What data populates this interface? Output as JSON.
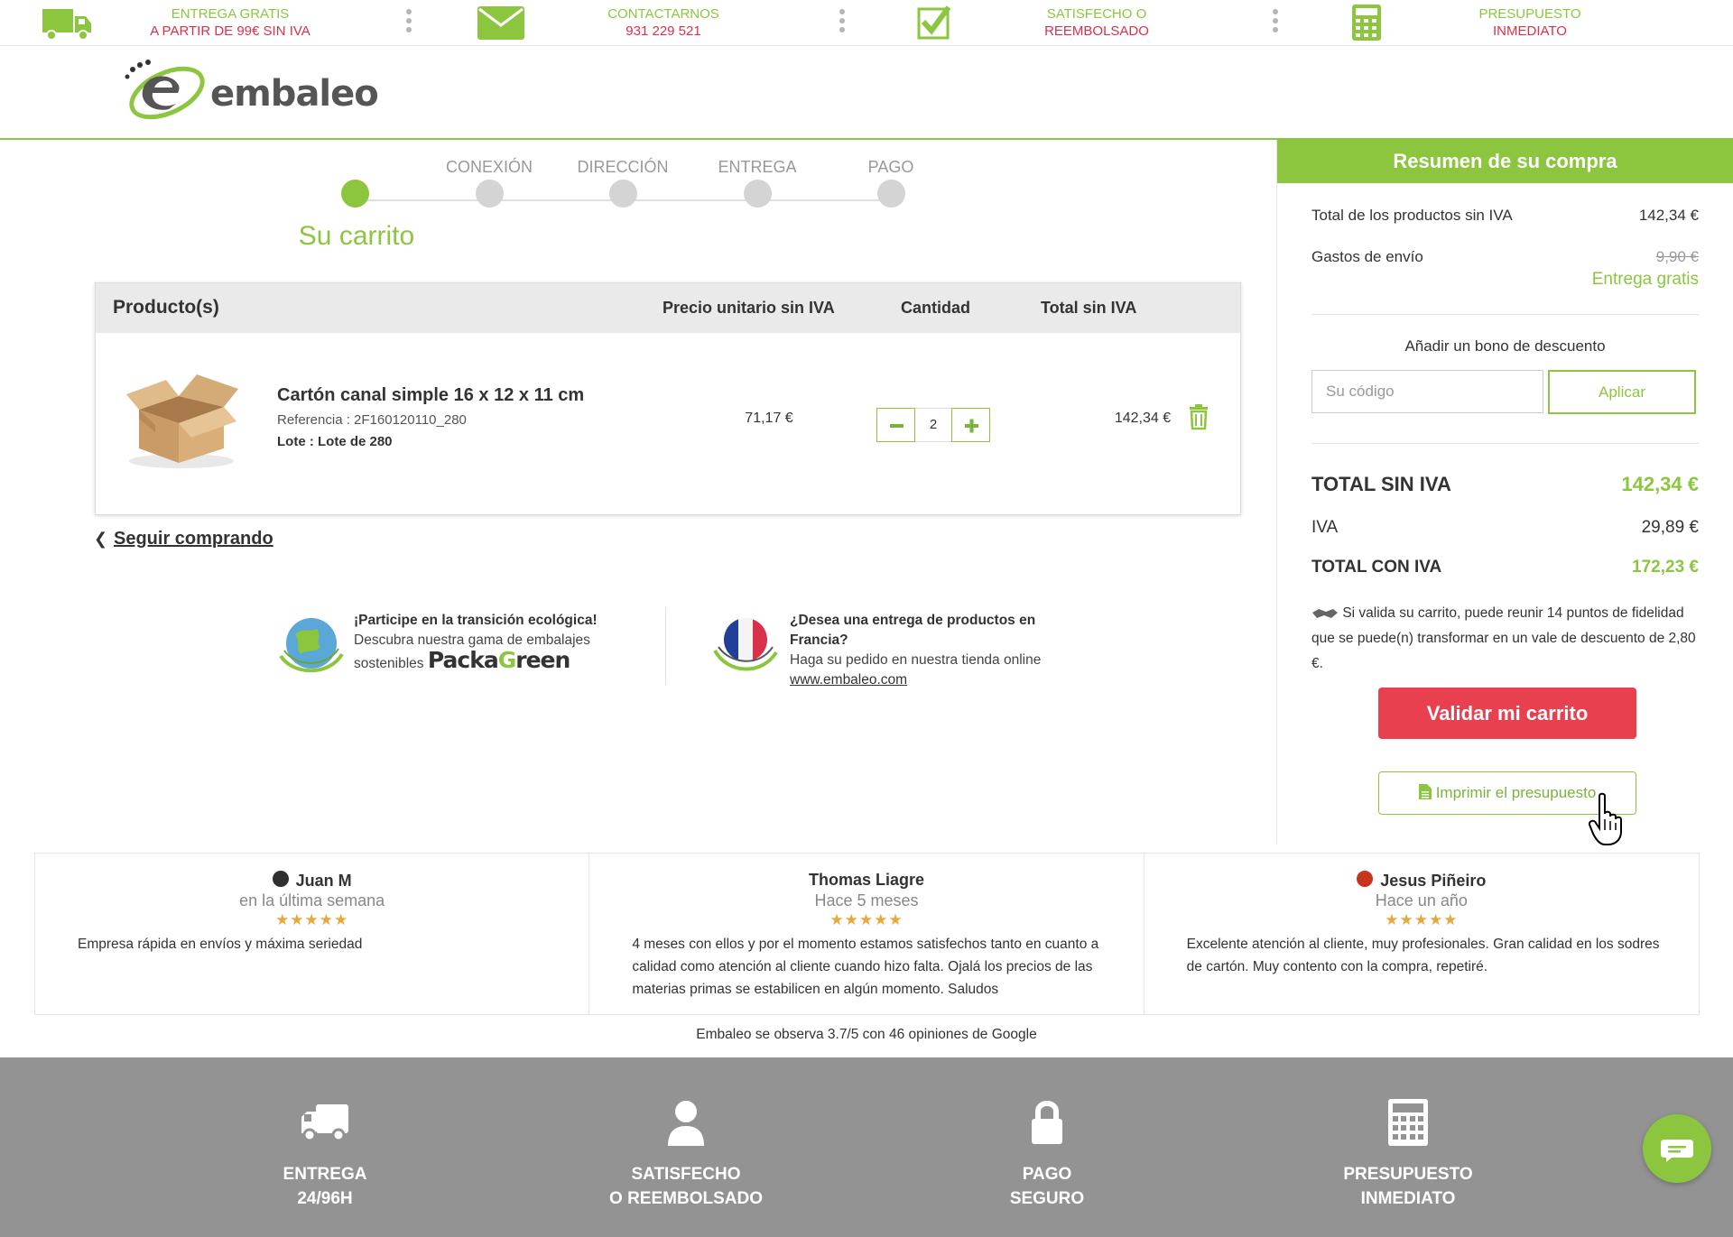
{
  "topbar": {
    "items": [
      {
        "icon": "truck-icon",
        "line1": "ENTREGA GRATIS",
        "line2": "A PARTIR DE 99€ SIN IVA"
      },
      {
        "icon": "envelope-icon",
        "line1": "CONTACTARNOS",
        "line2": "931 229 521"
      },
      {
        "icon": "checkbox-icon",
        "line1": "SATISFECHO O",
        "line2": "REEMBOLSADO"
      },
      {
        "icon": "calculator-icon",
        "line1": "PRESUPUESTO",
        "line2": "INMEDIATO"
      }
    ]
  },
  "logo": {
    "text": "embaleo"
  },
  "steps": {
    "items": [
      {
        "label": ""
      },
      {
        "label": "CONEXIÓN"
      },
      {
        "label": "DIRECCIÓN"
      },
      {
        "label": "ENTREGA"
      },
      {
        "label": "PAGO"
      }
    ],
    "current": "Su carrito"
  },
  "cart": {
    "headers": {
      "product": "Producto(s)",
      "unit_price": "Precio unitario sin IVA",
      "quantity": "Cantidad",
      "total": "Total sin IVA"
    },
    "items": [
      {
        "name": "Cartón canal simple 16 x 12 x 11 cm",
        "reference": "Referencia : 2F160120110_280",
        "lot": "Lote : Lote de 280",
        "unit_price": "71,17 €",
        "quantity": "2",
        "total": "142,34 €"
      }
    ]
  },
  "continue_shopping": "Seguir comprando",
  "promos": {
    "eco": {
      "title": "¡Participe en la transición ecológica!",
      "line1": "Descubra nuestra gama de embalajes",
      "line2": "sostenibles",
      "brand_a": "Packa",
      "brand_b": "G",
      "brand_c": "reen"
    },
    "france": {
      "title": "¿Desea una entrega de productos en Francia?",
      "line1": "Haga su pedido en nuestra tienda online",
      "link": "www.embaleo.com"
    }
  },
  "summary": {
    "title": "Resumen de su compra",
    "products_label": "Total de los productos sin IVA",
    "products_value": "142,34 €",
    "shipping_label": "Gastos de envío",
    "shipping_old": "9,90 €",
    "shipping_free": "Entrega gratis",
    "coupon_label": "Añadir un bono de descuento",
    "coupon_placeholder": "Su código",
    "coupon_button": "Aplicar",
    "total_excl_label": "TOTAL SIN IVA",
    "total_excl_value": "142,34 €",
    "vat_label": "IVA",
    "vat_value": "29,89 €",
    "total_incl_label": "TOTAL CON IVA",
    "total_incl_value": "172,23 €",
    "loyalty_text": "Si valida su carrito, puede reunir 14 puntos de fidelidad que se puede(n) transformar en un vale de descuento de 2,80 €.",
    "validate_button": "Validar mi carrito",
    "print_button": "Imprimir el presupuesto"
  },
  "reviews": {
    "items": [
      {
        "author": "Juan M",
        "date": "en la última semana",
        "stars": "★★★★★",
        "text": "Empresa rápida en envíos y máxima seriedad",
        "avatar": "dark"
      },
      {
        "author": "Thomas Liagre",
        "date": "Hace 5 meses",
        "stars": "★★★★★",
        "text": "4 meses con ellos y por el momento estamos satisfechos tanto en cuanto a calidad como atención al cliente cuando hizo falta. Ojalá los precios de las materias primas se estabilicen en algún momento. Saludos",
        "avatar": ""
      },
      {
        "author": "Jesus Piñeiro",
        "date": "Hace un año",
        "stars": "★★★★★",
        "text": "Excelente atención al cliente, muy profesionales. Gran calidad en los sodres de cartón. Muy contento con la compra, repetiré.",
        "avatar": "red"
      }
    ],
    "summary": "Embaleo se observa 3.7/5 con 46 opiniones de Google"
  },
  "footer": {
    "items": [
      {
        "icon": "truck-icon",
        "line1": "ENTREGA",
        "line2": "24/96H"
      },
      {
        "icon": "user-icon",
        "line1": "SATISFECHO",
        "line2": "O REEMBOLSADO"
      },
      {
        "icon": "lock-icon",
        "line1": "PAGO",
        "line2": "SEGURO"
      },
      {
        "icon": "calculator-icon",
        "line1": "PRESUPUESTO",
        "line2": "INMEDIATO"
      }
    ]
  },
  "colors": {
    "brand_green": "#8cc63f",
    "alert_red": "#d9304b",
    "validate_red": "#e8404f",
    "footer_gray": "#939393"
  }
}
